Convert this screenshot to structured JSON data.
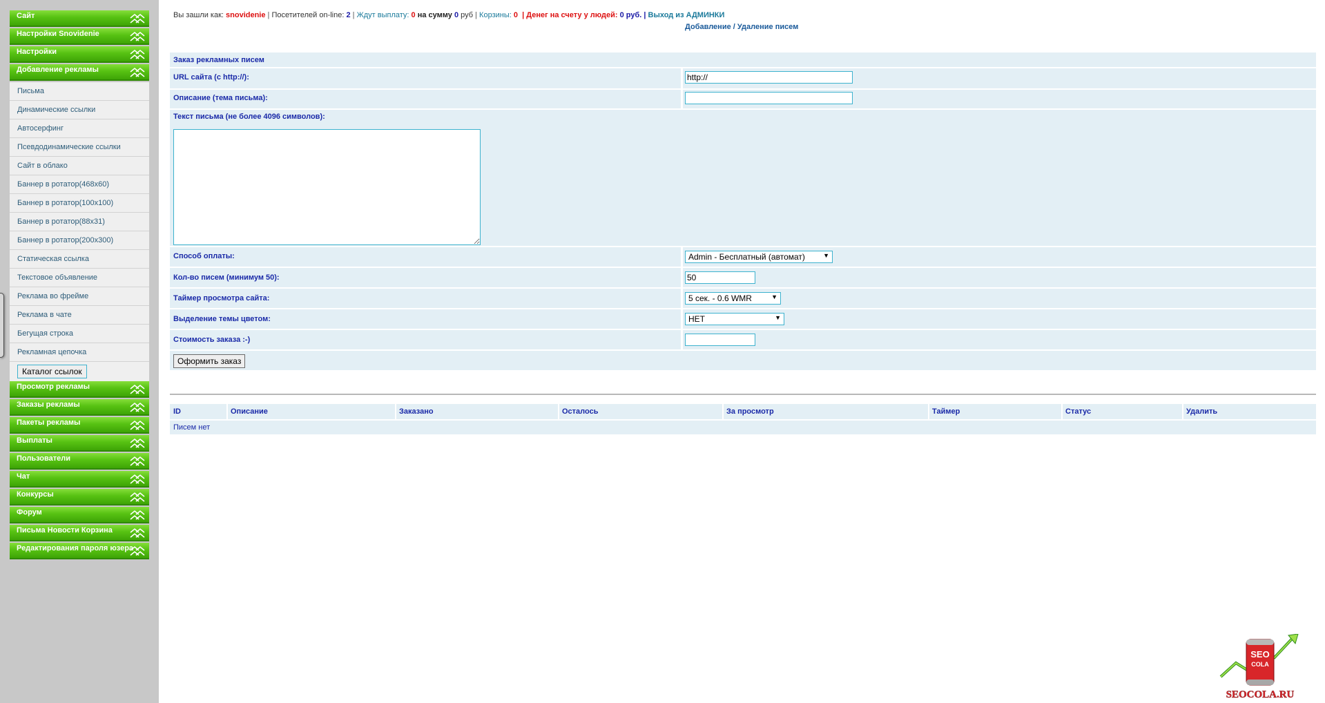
{
  "sidebar": {
    "groups_top": [
      {
        "label": "Сайт"
      },
      {
        "label": "Настройки Snovidenie"
      },
      {
        "label": "Настройки"
      },
      {
        "label": "Добавление рекламы"
      }
    ],
    "sub_items": [
      {
        "label": "Письма"
      },
      {
        "label": "Динамические ссылки"
      },
      {
        "label": "Автосерфинг"
      },
      {
        "label": "Псевдодинамические ссылки"
      },
      {
        "label": "Сайт в облако"
      },
      {
        "label": "Баннер в ротатор(468x60)"
      },
      {
        "label": "Баннер в ротатор(100x100)"
      },
      {
        "label": "Баннер в ротатор(88x31)"
      },
      {
        "label": "Баннер в ротатор(200x300)"
      },
      {
        "label": "Статическая ссылка"
      },
      {
        "label": "Текстовое объявление"
      },
      {
        "label": "Реклама во фрейме"
      },
      {
        "label": "Реклама в чате"
      },
      {
        "label": "Бегущая строка"
      },
      {
        "label": "Рекламная цепочка"
      }
    ],
    "catalog_button": "Каталог ссылок",
    "groups_bottom": [
      {
        "label": "Просмотр рекламы"
      },
      {
        "label": "Заказы рекламы"
      },
      {
        "label": "Пакеты рекламы"
      },
      {
        "label": "Выплаты"
      },
      {
        "label": "Пользователи"
      },
      {
        "label": "Чат"
      },
      {
        "label": "Конкурсы"
      },
      {
        "label": "Форум"
      },
      {
        "label": "Письма Новости Корзина"
      },
      {
        "label": "Редактирования пароля юзера"
      }
    ]
  },
  "topbar": {
    "logged_as_label": "Вы зашли как:",
    "username": "snovidenie",
    "online_label": "Посетителей on-line:",
    "online_count": "2",
    "awaiting_label": "Ждут выплату:",
    "awaiting_count": "0",
    "sum_label": "на сумму",
    "sum_value": "0",
    "currency": "руб",
    "carts_label": "Корзины:",
    "carts_count": "0",
    "money_label": "Денег на счету у людей:",
    "money_value": "0 руб.",
    "logout": "Выход из АДМИНКИ"
  },
  "subnav": {
    "add": "Добавление",
    "slash": "/",
    "delete": "Удаление писем"
  },
  "form": {
    "title": "Заказ рекламных писем",
    "url_label": "URL сайта (с http://):",
    "url_value": "http://",
    "desc_label": "Описание (тема письма):",
    "desc_value": "",
    "text_label": "Текст письма (не более 4096 символов):",
    "payment_label": "Способ оплаты:",
    "payment_value": "Admin - Бесплатный (автомат)",
    "count_label": "Кол-во писем (минимум 50):",
    "count_value": "50",
    "timer_label": "Таймер просмотра сайта:",
    "timer_value": "5 сек. - 0.6 WMR",
    "color_label": "Выделение темы цветом:",
    "color_value": "НЕТ",
    "cost_label": "Стоимость заказа :-)",
    "cost_value": "",
    "submit": "Оформить заказ"
  },
  "letters_table": {
    "columns": [
      "ID",
      "Описание",
      "Заказано",
      "Осталось",
      "За просмотр",
      "Таймер",
      "Статус",
      "Удалить"
    ],
    "empty_text": "Писем нет"
  },
  "logo": {
    "can_text_1": "SEO",
    "can_text_2": "COLA",
    "site": "SEOCOLA.RU"
  },
  "colors": {
    "menu_green": "#57c213",
    "label_blue": "#1a2aa8",
    "row_bg": "#e3eff5",
    "input_border": "#3cb2ce",
    "logo_red": "#d8262a"
  }
}
